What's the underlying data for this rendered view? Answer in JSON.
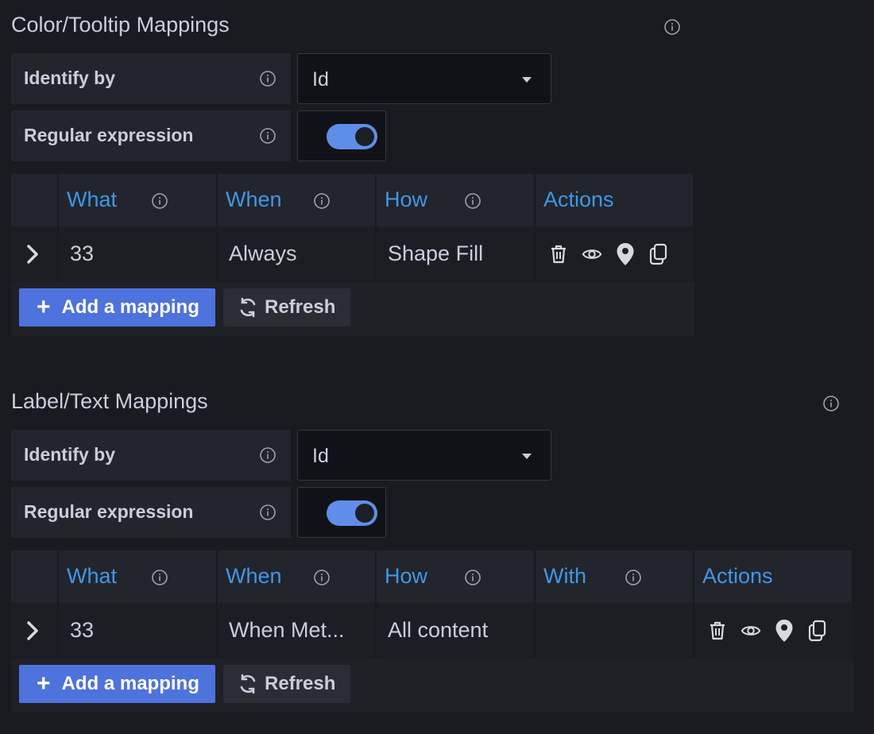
{
  "color_section": {
    "title": "Color/Tooltip Mappings",
    "identify_label": "Identify by",
    "identify_value": "Id",
    "regex_label": "Regular expression",
    "regex_enabled": true,
    "columns": [
      "What",
      "When",
      "How",
      "Actions"
    ],
    "row": {
      "what": "33",
      "when": "Always",
      "how": "Shape Fill"
    },
    "add_label": "Add a mapping",
    "refresh_label": "Refresh"
  },
  "label_section": {
    "title": "Label/Text Mappings",
    "identify_label": "Identify by",
    "identify_value": "Id",
    "regex_label": "Regular expression",
    "regex_enabled": true,
    "columns": [
      "What",
      "When",
      "How",
      "With",
      "Actions"
    ],
    "row": {
      "what": "33",
      "when": "When Met...",
      "how": "All content",
      "with": ""
    },
    "add_label": "Add a mapping",
    "refresh_label": "Refresh"
  },
  "icons": [
    "info-icon",
    "chevron-down-icon",
    "chevron-right-icon",
    "trash-icon",
    "eye-icon",
    "map-pin-icon",
    "copy-icon",
    "plus-icon",
    "refresh-icon"
  ],
  "colors": {
    "background": "#181b1f",
    "header_text": "#3f97e8",
    "primary_button": "#4e72de",
    "switch_on": "#5f8ee8"
  }
}
